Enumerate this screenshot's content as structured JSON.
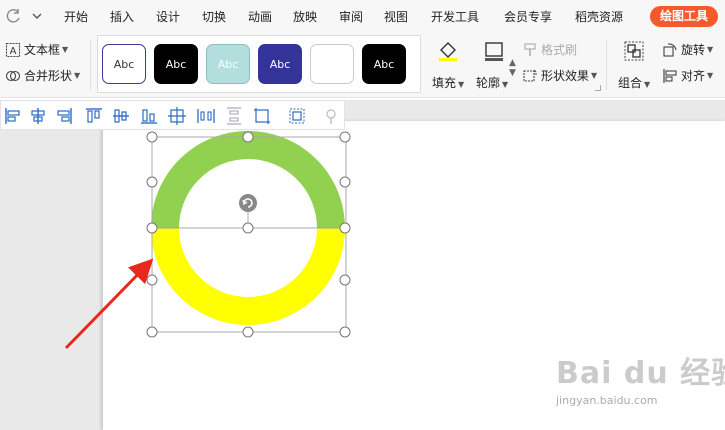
{
  "menu": {
    "tabs": [
      "开始",
      "插入",
      "设计",
      "切换",
      "动画",
      "放映",
      "审阅",
      "视图",
      "开发工具",
      "会员专享",
      "稻壳资源"
    ],
    "active_tab": "绘图工具"
  },
  "ribbon": {
    "text_box": "文本框",
    "merge_shapes": "合并形状",
    "style_swatches": [
      {
        "label": "Abc",
        "bg": "#ffffff",
        "fg": "#333333",
        "border": "#3b3b9a"
      },
      {
        "label": "Abc",
        "bg": "#000000",
        "fg": "#ffffff",
        "border": "#000000"
      },
      {
        "label": "Abc",
        "bg": "#b2dede",
        "fg": "#ffffff",
        "border": "#8fbcbc"
      },
      {
        "label": "Abc",
        "bg": "#33339a",
        "fg": "#ffffff",
        "border": "#33339a"
      },
      {
        "label": "",
        "bg": "#ffffff",
        "fg": "#333333",
        "border": "#cccccc"
      },
      {
        "label": "Abc",
        "bg": "#000000",
        "fg": "#ffffff",
        "border": "#000000"
      }
    ],
    "fill": "填充",
    "outline": "轮廓",
    "format_painter": "格式刷",
    "shape_effects": "形状效果",
    "group": "组合",
    "rotate": "旋转",
    "align": "对齐"
  },
  "canvas": {
    "ring_top_color": "#92d050",
    "ring_bottom_color": "#ffff00",
    "arrow_color": "#e8271e"
  },
  "watermark": {
    "logo": "Bai du 经验",
    "url": "jingyan.baidu.com"
  }
}
